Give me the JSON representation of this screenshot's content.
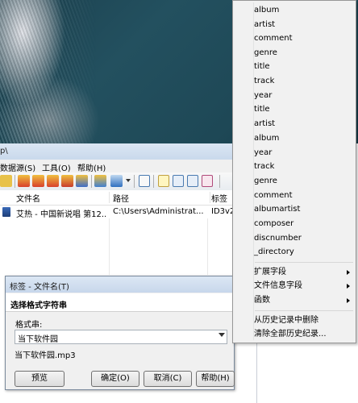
{
  "window": {
    "title_fragment": "p\\"
  },
  "menubar": {
    "items": [
      "数据源(S)",
      "工具(O)",
      "帮助(H)"
    ]
  },
  "columns": {
    "filename": "文件名",
    "path": "路径",
    "tag": "标签"
  },
  "file_row": {
    "filename": "艾热 - 中国新说唱 第12...",
    "path": "C:\\Users\\Administrat...",
    "tag": "ID3v2"
  },
  "dialog": {
    "title": "标签 - 文件名(T)",
    "heading": "选择格式字符串",
    "format_label": "格式串:",
    "format_value": "当下软件园",
    "preview": "当下软件园.mp3",
    "buttons": {
      "preview": "预览",
      "ok": "确定(O)",
      "cancel": "取消(C)",
      "help": "帮助(H)"
    }
  },
  "context_menu": {
    "fields": [
      "album",
      "artist",
      "comment",
      "genre",
      "title",
      "track",
      "year",
      "title",
      "artist",
      "album",
      "year",
      "track",
      "genre",
      "comment",
      "albumartist",
      "composer",
      "discnumber",
      "_directory"
    ],
    "submenus": [
      "扩展字段",
      "文件信息字段",
      "函数"
    ],
    "history": [
      "从历史记录中删除",
      "清除全部历史纪录..."
    ]
  },
  "colors": {
    "menu_bg": "#f1f1f1",
    "titlebar": "#c9d9ec",
    "photo": "#1e4856"
  },
  "icons": {
    "music_file": "music-note-icon",
    "dropdown": "chevron-down-icon",
    "submenu": "chevron-right-icon"
  }
}
